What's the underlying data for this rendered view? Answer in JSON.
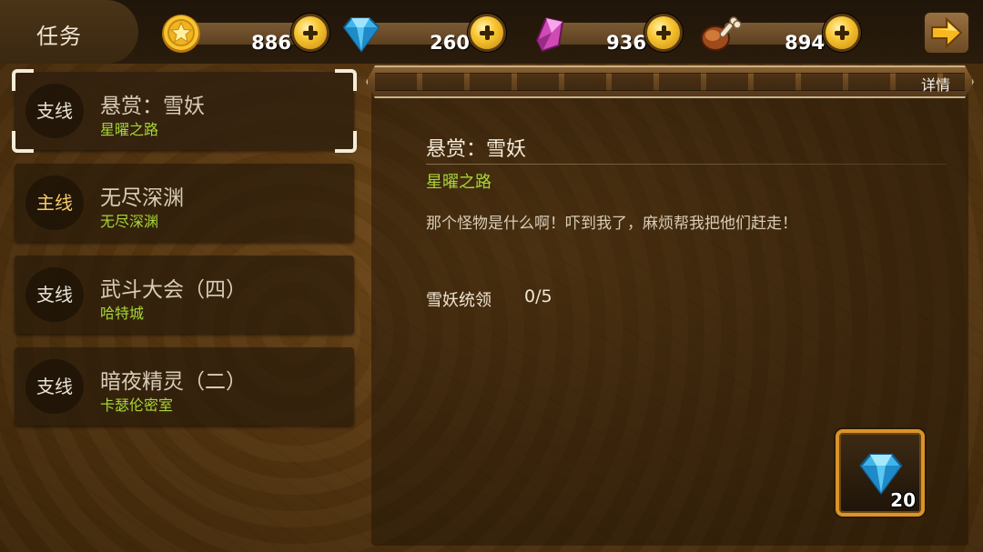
{
  "header": {
    "title": "任务",
    "resources": [
      {
        "id": "gold",
        "icon": "gold-coin-icon",
        "value": "886"
      },
      {
        "id": "diamond",
        "icon": "blue-diamond-icon",
        "value": "260"
      },
      {
        "id": "crystal",
        "icon": "pink-crystal-icon",
        "value": "936"
      },
      {
        "id": "meat",
        "icon": "meat-drumstick-icon",
        "value": "894"
      }
    ],
    "next_icon": "arrow-right-icon"
  },
  "quests": [
    {
      "type": "支线",
      "title": "悬赏：雪妖",
      "location": "星曜之路",
      "selected": true
    },
    {
      "type": "主线",
      "title": "无尽深渊",
      "location": "无尽深渊",
      "selected": false
    },
    {
      "type": "支线",
      "title": "武斗大会（四）",
      "location": "哈特城",
      "selected": false
    },
    {
      "type": "支线",
      "title": "暗夜精灵（二）",
      "location": "卡瑟伦密室",
      "selected": false
    }
  ],
  "detail": {
    "tab_label": "详情",
    "title": "悬赏：雪妖",
    "location": "星曜之路",
    "description": "那个怪物是什么啊！吓到我了，麻烦帮我把他们赶走！",
    "objective_label": "雪妖统领",
    "objective_progress": "0/5",
    "reward": {
      "icon": "blue-diamond-icon",
      "count": "20"
    }
  },
  "colors": {
    "location_green": "#a6d637",
    "main_quest_gold": "#f5c96b",
    "reward_border": "#d9942a"
  }
}
